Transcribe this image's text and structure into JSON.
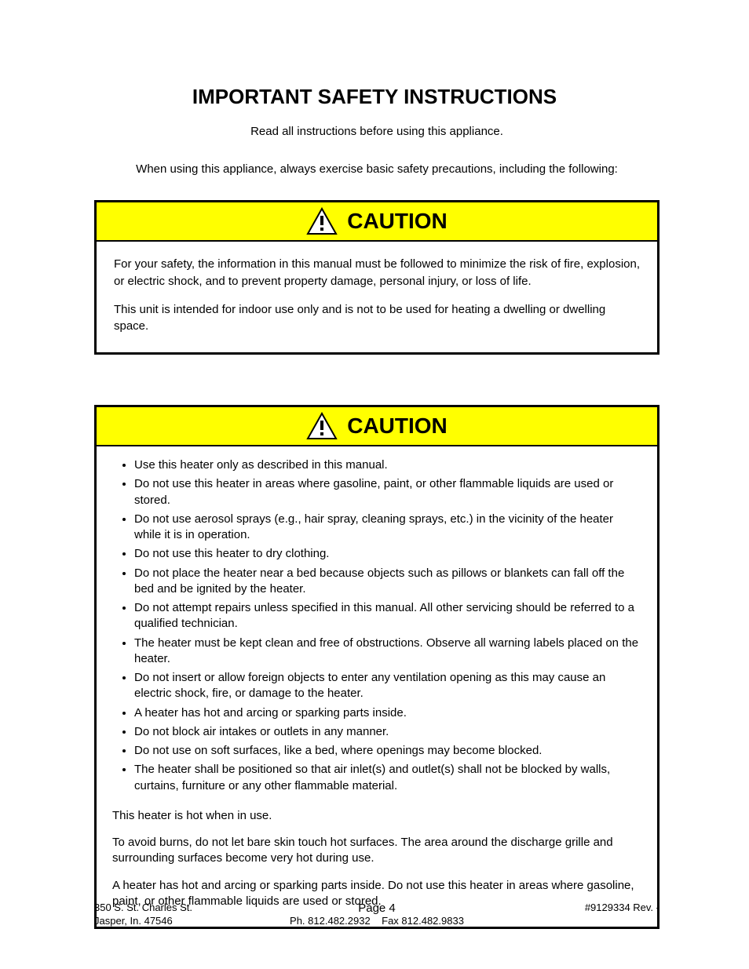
{
  "title": "IMPORTANT SAFETY INSTRUCTIONS",
  "intro1": "Read all instructions before using this appliance.",
  "intro2": "When using this appliance, always exercise basic safety precautions, including the following:",
  "caution1": {
    "label": "CAUTION",
    "p1": "For your safety, the information in this manual must be followed to minimize the risk of fire, explosion, or electric shock, and to prevent property damage, personal injury, or loss of life.",
    "p2": "This unit is intended for indoor use only and is not to be used for heating a dwelling or dwelling space."
  },
  "caution2": {
    "label": "CAUTION",
    "bullets": [
      "Use this heater only as described in this manual.",
      "Do not use this heater in areas where gasoline, paint, or other flammable liquids are used or stored.",
      "Do not use aerosol sprays (e.g., hair spray, cleaning sprays, etc.) in the vicinity of the heater while it is in operation.",
      "Do not use this heater to dry clothing.",
      "Do not place the heater near a bed because objects such as pillows or blankets can fall off the bed and be ignited by the heater.",
      "Do not attempt repairs unless specified in this manual. All other servicing should be referred to a qualified technician.",
      "The heater must be kept clean and free of obstructions. Observe all warning labels placed on the heater.",
      "Do not insert or allow foreign objects to enter any ventilation opening as this may cause an electric shock, fire, or damage to the heater.",
      "A heater has hot and arcing or sparking parts inside.",
      "Do not block air intakes or outlets in any manner.",
      "Do not use on soft surfaces, like a bed, where openings may become blocked.",
      "The heater shall be positioned so that air inlet(s) and outlet(s) shall not be blocked by walls, curtains, furniture or any other flammable material."
    ],
    "p1": "This heater is hot when in use.",
    "p2": "To avoid burns, do not let bare skin touch hot surfaces. The area around the discharge grille and surrounding surfaces become very hot during use.",
    "p3": "A heater has hot and arcing or sparking parts inside. Do not use this heater in areas where gasoline, paint, or other flammable liquids are used or stored."
  },
  "footer": {
    "left1": "350 S. St. Charles St.",
    "left2": "Jasper, In. 47546",
    "centerPage": "Page 4",
    "centerPh": "Ph. 812.482.2932",
    "centerFax": "Fax 812.482.9833",
    "right": "#9129334 Rev. -"
  }
}
